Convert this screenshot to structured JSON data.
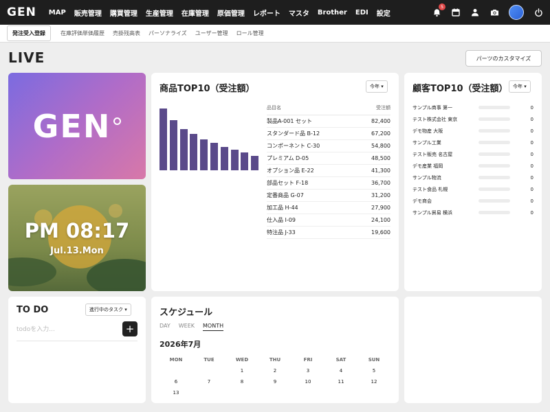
{
  "nav": {
    "logo": "GEN",
    "menu": [
      "MAP",
      "販売管理",
      "購買管理",
      "生産管理",
      "在庫管理",
      "原価管理",
      "レポート",
      "マスタ",
      "Brother",
      "EDI",
      "設定"
    ],
    "notification_count": "5"
  },
  "subnav": {
    "primary": "発注受入登録",
    "links": [
      "在庫評価単価履歴",
      "売掛残高表",
      "パーソナライズ",
      "ユーザー管理",
      "ロール管理"
    ]
  },
  "page": {
    "title": "LIVE",
    "customize": "パーツのカスタマイズ"
  },
  "logo_card": {
    "text": "GEN"
  },
  "clock": {
    "time": "PM 08:17",
    "date": "Jul.13.Mon"
  },
  "products": {
    "title": "商品TOP10（受注額）",
    "period": "今年 ▾",
    "col_name": "品目名",
    "col_value": "受注額",
    "rows": [
      {
        "name": "製品A-001 セット",
        "value": "82,400"
      },
      {
        "name": "スタンダード品 B-12",
        "value": "67,200"
      },
      {
        "name": "コンポーネント C-30",
        "value": "54,800"
      },
      {
        "name": "プレミアム D-05",
        "value": "48,500"
      },
      {
        "name": "オプション品 E-22",
        "value": "41,300"
      },
      {
        "name": "部品セット F-18",
        "value": "36,700"
      },
      {
        "name": "定番商品 G-07",
        "value": "31,200"
      },
      {
        "name": "加工品 H-44",
        "value": "27,900"
      },
      {
        "name": "仕入品 I-09",
        "value": "24,100"
      },
      {
        "name": "特注品 J-33",
        "value": "19,600"
      }
    ]
  },
  "chart_data": {
    "type": "bar",
    "categories": [
      "製品A-001 セット",
      "スタンダード品 B-12",
      "コンポーネント C-30",
      "プレミアム D-05",
      "オプション品 E-22",
      "部品セット F-18",
      "定番商品 G-07",
      "加工品 H-44",
      "仕入品 I-09",
      "特注品 J-33"
    ],
    "values": [
      82400,
      67200,
      54800,
      48500,
      41300,
      36700,
      31200,
      27900,
      24100,
      19600
    ],
    "ylim": [
      0,
      82400
    ],
    "color": "#5a4a8a"
  },
  "customers": {
    "title": "顧客TOP10（受注額）",
    "period": "今年 ▾",
    "rows": [
      {
        "name": "サンプル商事 第一",
        "value": "0"
      },
      {
        "name": "テスト株式会社 東京",
        "value": "0"
      },
      {
        "name": "デモ物産 大阪",
        "value": "0"
      },
      {
        "name": "サンプル工業",
        "value": "0"
      },
      {
        "name": "テスト販売 名古屋",
        "value": "0"
      },
      {
        "name": "デモ産業 福岡",
        "value": "0"
      },
      {
        "name": "サンプル物流",
        "value": "0"
      },
      {
        "name": "テスト食品 札幌",
        "value": "0"
      },
      {
        "name": "デモ商会",
        "value": "0"
      },
      {
        "name": "サンプル貿易 横浜",
        "value": "0"
      }
    ]
  },
  "todo": {
    "title": "TO DO",
    "filter": "進行中のタスク ▾",
    "placeholder": "todoを入力...",
    "add": "+"
  },
  "schedule": {
    "title": "スケジュール",
    "tabs": [
      "DAY",
      "WEEK",
      "MONTH"
    ],
    "month": "2026年7月",
    "weekdays": [
      "MON",
      "TUE",
      "WED",
      "THU",
      "FRI",
      "SAT",
      "SUN"
    ],
    "weeks": [
      [
        "",
        "",
        "1",
        "2",
        "3",
        "4",
        "5"
      ],
      [
        "6",
        "7",
        "8",
        "9",
        "10",
        "11",
        "12"
      ],
      [
        "13",
        "",
        "",
        "",
        "",
        "",
        ""
      ]
    ]
  },
  "colors": {
    "nav_bg": "#1e1e1e",
    "accent_bar": "#5a4a8a",
    "badge": "#e04848"
  }
}
